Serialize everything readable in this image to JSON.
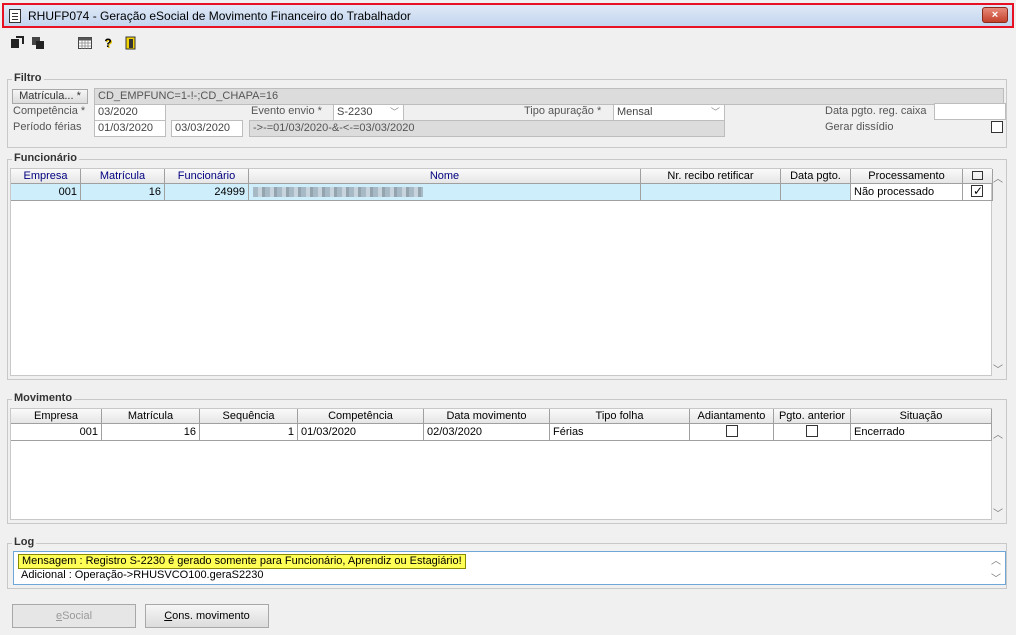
{
  "window": {
    "title": "RHUFP074 - Geração eSocial de Movimento Financeiro do Trabalhador",
    "close": "×"
  },
  "toolbar": {
    "icons": [
      "export-icon",
      "copy-icon",
      "calendar-icon",
      "help-icon",
      "exit-icon"
    ],
    "help_glyph": "?"
  },
  "filtro": {
    "label": "Filtro",
    "matricula_button": "Matrícula...",
    "required_mark": "*",
    "matricula_value": "CD_EMPFUNC=1-!-;CD_CHAPA=16",
    "competencia_label": "Competência *",
    "competencia_value": "03/2020",
    "evento_label": "Evento envio *",
    "evento_value": "S-2230",
    "tipo_apuracao_label": "Tipo apuração *",
    "tipo_apuracao_value": "Mensal",
    "data_pgto_label": "Data pgto. reg. caixa",
    "data_pgto_value": "",
    "periodo_label": "Período férias",
    "periodo_inicio": "01/03/2020",
    "periodo_fim": "03/03/2020",
    "periodo_expr": "->-=01/03/2020-&-<-=03/03/2020",
    "gerar_dissidio_label": "Gerar dissídio",
    "dropdown_glyph": "﹀"
  },
  "funcionario": {
    "label": "Funcionário",
    "columns": [
      "Empresa",
      "Matrícula",
      "Funcionário",
      "Nome",
      "Nr. recibo retificar",
      "Data pgto.",
      "Processamento"
    ],
    "row": {
      "empresa": "001",
      "matricula": "16",
      "funcionario": "24999",
      "nome": "",
      "recibo": "",
      "data_pgto": "",
      "processamento": "Não processado",
      "checked": true
    }
  },
  "movimento": {
    "label": "Movimento",
    "columns": [
      "Empresa",
      "Matrícula",
      "Sequência",
      "Competência",
      "Data movimento",
      "Tipo folha",
      "Adiantamento",
      "Pgto. anterior",
      "Situação"
    ],
    "row": {
      "empresa": "001",
      "matricula": "16",
      "sequencia": "1",
      "competencia": "01/03/2020",
      "data_movimento": "02/03/2020",
      "tipo_folha": "Férias",
      "adiantamento": false,
      "pgto_anterior": false,
      "situacao": "Encerrado"
    }
  },
  "log": {
    "label": "Log",
    "message": "Mensagem : Registro S-2230 é gerado somente para Funcionário, Aprendiz ou Estagiário!",
    "additional": "Adicional : Operação->RHUSVCO100.geraS2230"
  },
  "buttons": {
    "esocial_prefix": "e",
    "esocial_rest": "Social",
    "cons_prefix": "C",
    "cons_rest": "ons. movimento"
  },
  "scroll_glyphs": {
    "up": "︿",
    "down": "﹀"
  }
}
